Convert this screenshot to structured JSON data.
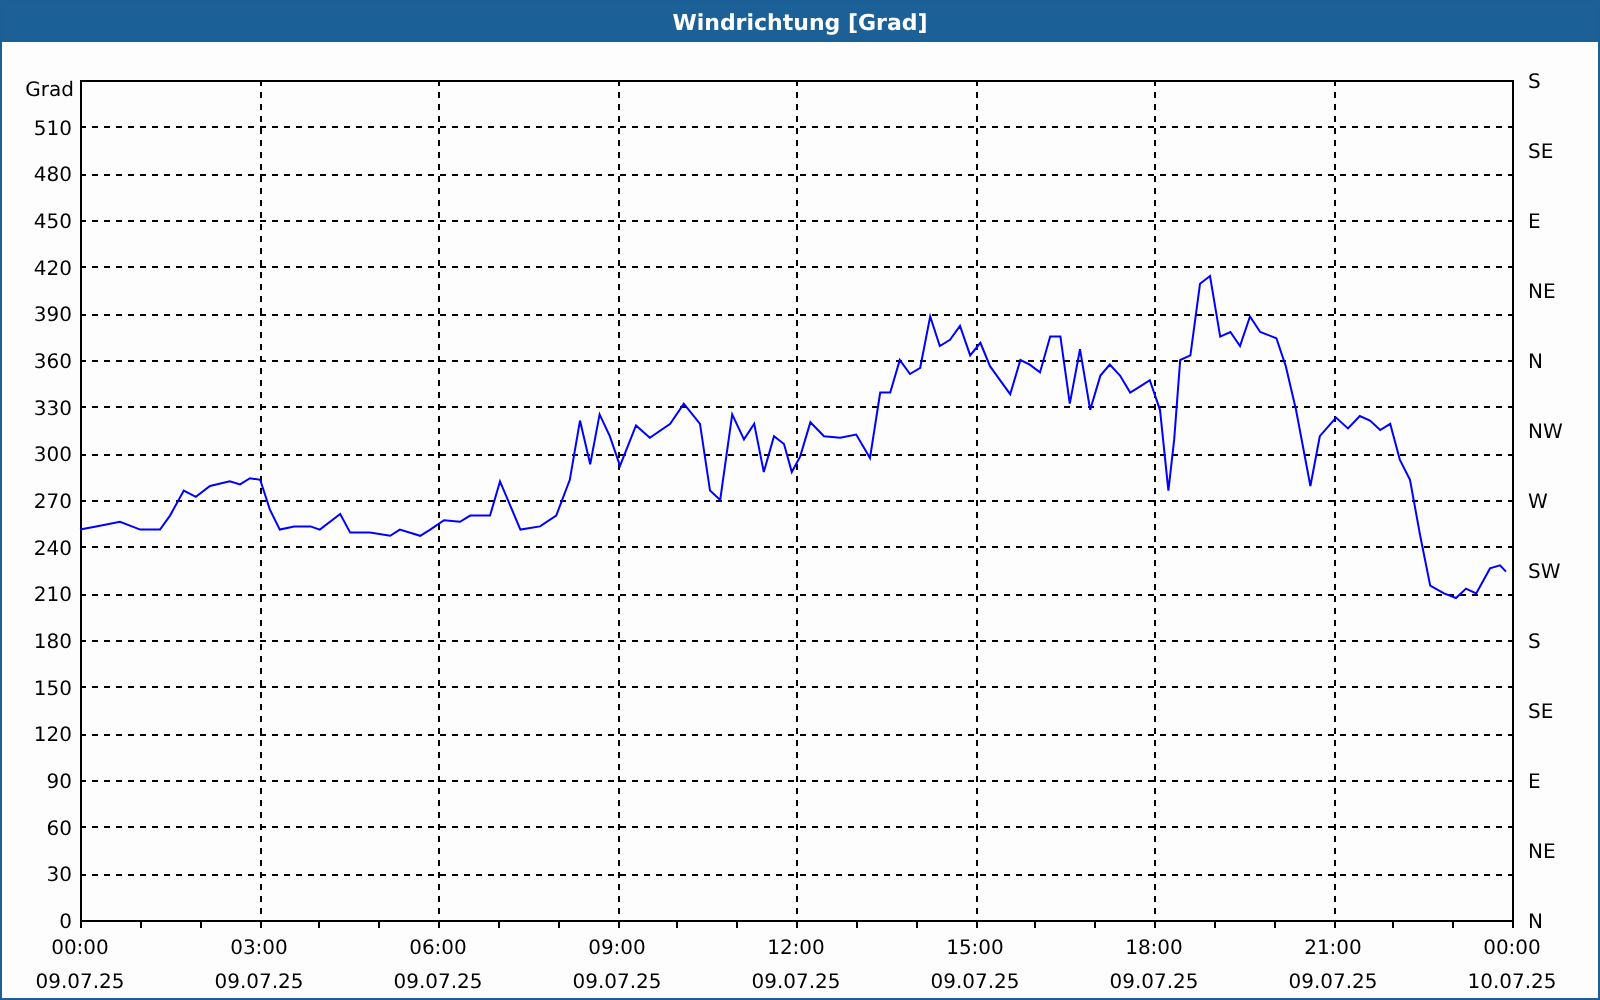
{
  "window": {
    "title": "Windrichtung [Grad]"
  },
  "chart": {
    "chart_data": {
      "type": "line",
      "ylabel": "Grad",
      "grid": true,
      "xlim": [
        0,
        24
      ],
      "ylim": [
        0,
        540
      ],
      "xticks": [
        {
          "value": 0,
          "label": "00:00"
        },
        {
          "value": 3,
          "label": "03:00"
        },
        {
          "value": 6,
          "label": "06:00"
        },
        {
          "value": 9,
          "label": "09:00"
        },
        {
          "value": 12,
          "label": "12:00"
        },
        {
          "value": 15,
          "label": "15:00"
        },
        {
          "value": 18,
          "label": "18:00"
        },
        {
          "value": 21,
          "label": "21:00"
        },
        {
          "value": 24,
          "label": "00:00"
        }
      ],
      "yticks": [
        0,
        30,
        60,
        90,
        120,
        150,
        180,
        210,
        240,
        270,
        300,
        330,
        360,
        390,
        420,
        450,
        480,
        510
      ],
      "x": [
        0,
        0.27,
        0.67,
        1.01,
        1.34,
        1.51,
        1.74,
        1.94,
        2.18,
        2.51,
        2.68,
        2.85,
        3.02,
        3.18,
        3.35,
        3.59,
        3.86,
        4.02,
        4.36,
        4.53,
        4.86,
        5.2,
        5.36,
        5.7,
        5.87,
        6.1,
        6.37,
        6.54,
        6.87,
        7.04,
        7.38,
        7.71,
        7.98,
        8.21,
        8.38,
        8.55,
        8.71,
        8.88,
        9.05,
        9.32,
        9.55,
        9.89,
        10.12,
        10.39,
        10.56,
        10.73,
        10.93,
        11.13,
        11.3,
        11.46,
        11.63,
        11.8,
        11.93,
        12.07,
        12.24,
        12.47,
        12.74,
        13.01,
        13.24,
        13.41,
        13.58,
        13.74,
        13.91,
        14.08,
        14.25,
        14.41,
        14.58,
        14.75,
        14.92,
        15.09,
        15.25,
        15.42,
        15.59,
        15.76,
        15.92,
        16.09,
        16.26,
        16.43,
        16.59,
        16.76,
        16.93,
        17.1,
        17.26,
        17.43,
        17.6,
        17.77,
        17.93,
        18.1,
        18.24,
        18.34,
        18.44,
        18.61,
        18.77,
        18.94,
        19.11,
        19.28,
        19.44,
        19.61,
        19.78,
        20.05,
        20.21,
        20.38,
        20.62,
        20.78,
        21.05,
        21.25,
        21.45,
        21.62,
        21.79,
        21.96,
        22.12,
        22.29,
        22.46,
        22.63,
        22.86,
        23.06,
        23.23,
        23.4,
        23.63,
        23.8,
        23.9
      ],
      "series": [
        {
          "color": "#0000ff",
          "values": [
            251,
            253,
            256,
            251,
            251,
            260,
            276,
            272,
            279,
            282,
            280,
            284,
            283,
            264,
            251,
            253,
            253,
            251,
            261,
            249,
            249,
            247,
            251,
            247,
            251,
            257,
            256,
            260,
            260,
            282,
            251,
            253,
            260,
            283,
            321,
            293,
            325,
            311,
            292,
            318,
            310,
            319,
            332,
            319,
            276,
            270,
            325,
            309,
            319,
            288,
            311,
            306,
            288,
            298,
            320,
            311,
            310,
            312,
            297,
            339,
            339,
            360,
            351,
            355,
            388,
            369,
            373,
            382,
            363,
            371,
            356,
            347,
            338,
            360,
            357,
            352,
            375,
            375,
            332,
            367,
            328,
            350,
            357,
            350,
            339,
            343,
            347,
            328,
            276,
            309,
            360,
            363,
            409,
            414,
            375,
            378,
            369,
            388,
            378,
            374,
            356,
            328,
            279,
            311,
            323,
            316,
            324,
            321,
            315,
            319,
            296,
            283,
            247,
            215,
            210,
            207,
            213,
            210,
            226,
            228,
            224
          ]
        }
      ]
    },
    "x_date_labels": [
      "09.07.25",
      "09.07.25",
      "09.07.25",
      "09.07.25",
      "09.07.25",
      "09.07.25",
      "09.07.25",
      "09.07.25",
      "10.07.25"
    ],
    "compass_labels": [
      "S",
      "SE",
      "E",
      "NE",
      "N",
      "NW",
      "W",
      "SW",
      "S",
      "SE",
      "E",
      "NE",
      "N"
    ]
  }
}
